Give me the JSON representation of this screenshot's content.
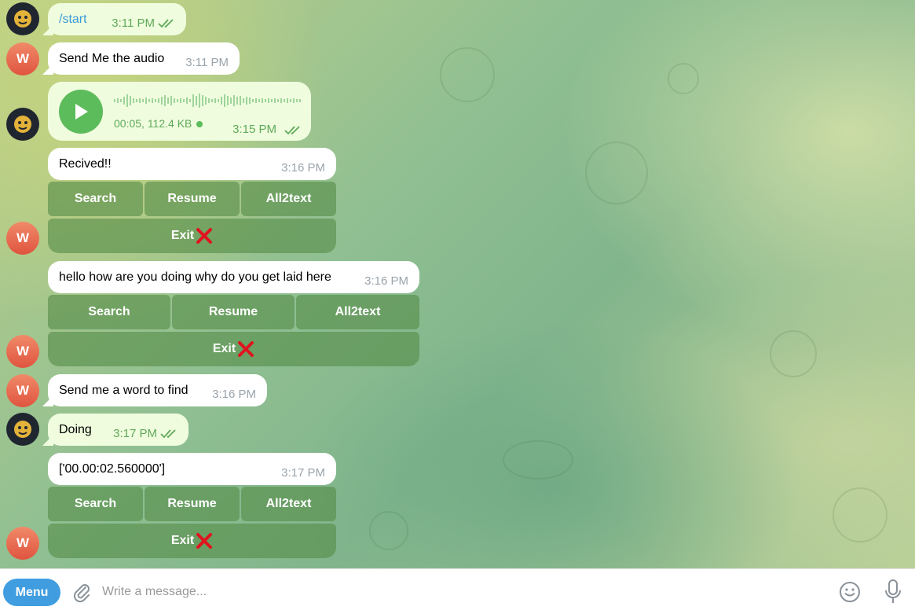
{
  "avatars": {
    "user_initial": "W"
  },
  "messages": [
    {
      "text": "/start",
      "time": "3:11 PM"
    },
    {
      "text": "Send Me the audio",
      "time": "3:11 PM"
    },
    {
      "voice_meta": "00:05, 112.4 KB",
      "time": "3:15 PM"
    },
    {
      "text": "Recived!!",
      "time": "3:16 PM"
    },
    {
      "text": "hello how are you doing why do you get laid here",
      "time": "3:16 PM"
    },
    {
      "text": "Send me a word to find",
      "time": "3:16 PM"
    },
    {
      "text": "Doing",
      "time": "3:17 PM"
    },
    {
      "text": "['00.00:02.560000']",
      "time": "3:17 PM"
    }
  ],
  "keyboard": {
    "search": "Search",
    "resume": "Resume",
    "all2text": "All2text",
    "exit": "Exit"
  },
  "composer": {
    "menu_label": "Menu",
    "placeholder": "Write a message..."
  },
  "colors": {
    "accent": "#3f9de0",
    "outgoing_bubble": "#effdde",
    "keyboard_button": "#568c48",
    "avatar_user": "#e0543f"
  },
  "icons": [
    "bot-avatar-icon",
    "play-icon",
    "double-check-icon",
    "cross-mark-icon",
    "paperclip-icon",
    "emoji-icon",
    "microphone-icon"
  ]
}
